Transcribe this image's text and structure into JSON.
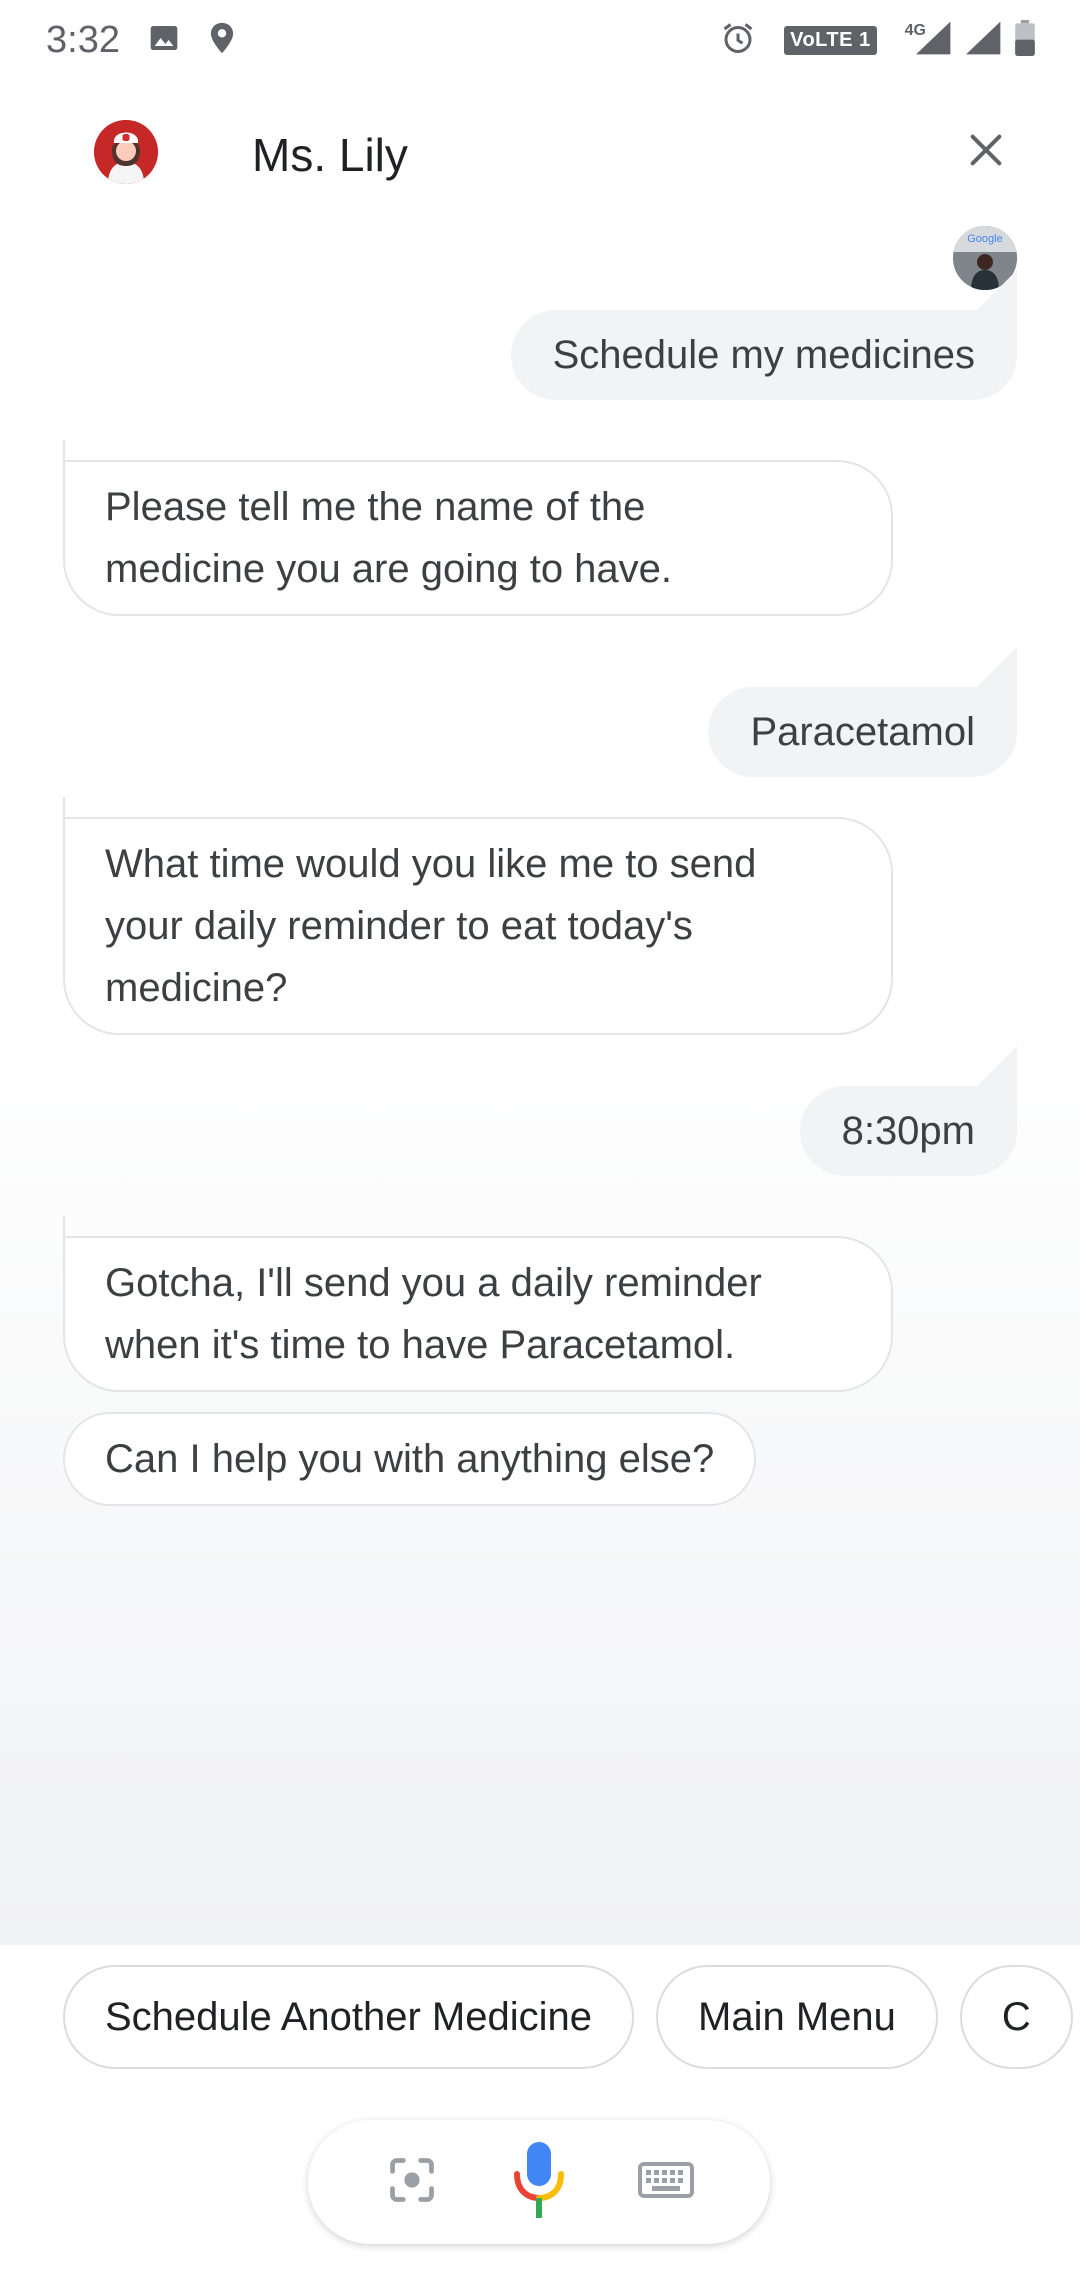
{
  "status_bar": {
    "time": "3:32",
    "volte": "VoLTE 1",
    "network": "4G",
    "icons": [
      "image-icon",
      "location-icon",
      "alarm-icon",
      "signal-icon",
      "battery-icon"
    ]
  },
  "header": {
    "agent_name": "Ms. Lily",
    "close_icon": "close-icon"
  },
  "messages": [
    {
      "from": "user",
      "text": "Schedule my medicines"
    },
    {
      "from": "bot",
      "lines": [
        "Please tell me the name of the",
        "medicine you are going to have."
      ]
    },
    {
      "from": "user",
      "text": "Paracetamol"
    },
    {
      "from": "bot",
      "lines": [
        "What time would you like me to send",
        "your daily reminder to eat today's",
        "medicine?"
      ]
    },
    {
      "from": "user",
      "text": "8:30pm"
    },
    {
      "from": "bot",
      "lines": [
        "Gotcha, I'll send you a daily reminder",
        "when it's time to have Paracetamol."
      ]
    },
    {
      "from": "bot",
      "text": "Can I help you with anything else?"
    }
  ],
  "suggestions": [
    "Schedule Another Medicine",
    "Main Menu",
    "C"
  ],
  "toolbar": {
    "icons": [
      "lens-icon",
      "microphone-icon",
      "keyboard-icon"
    ]
  },
  "colors": {
    "user_bubble": "#f1f3f4",
    "bot_border": "#e3e5e8",
    "mic_blue": "#4285f4",
    "mic_red": "#ea4335",
    "mic_yellow": "#fbbc05",
    "mic_green": "#34a853"
  }
}
